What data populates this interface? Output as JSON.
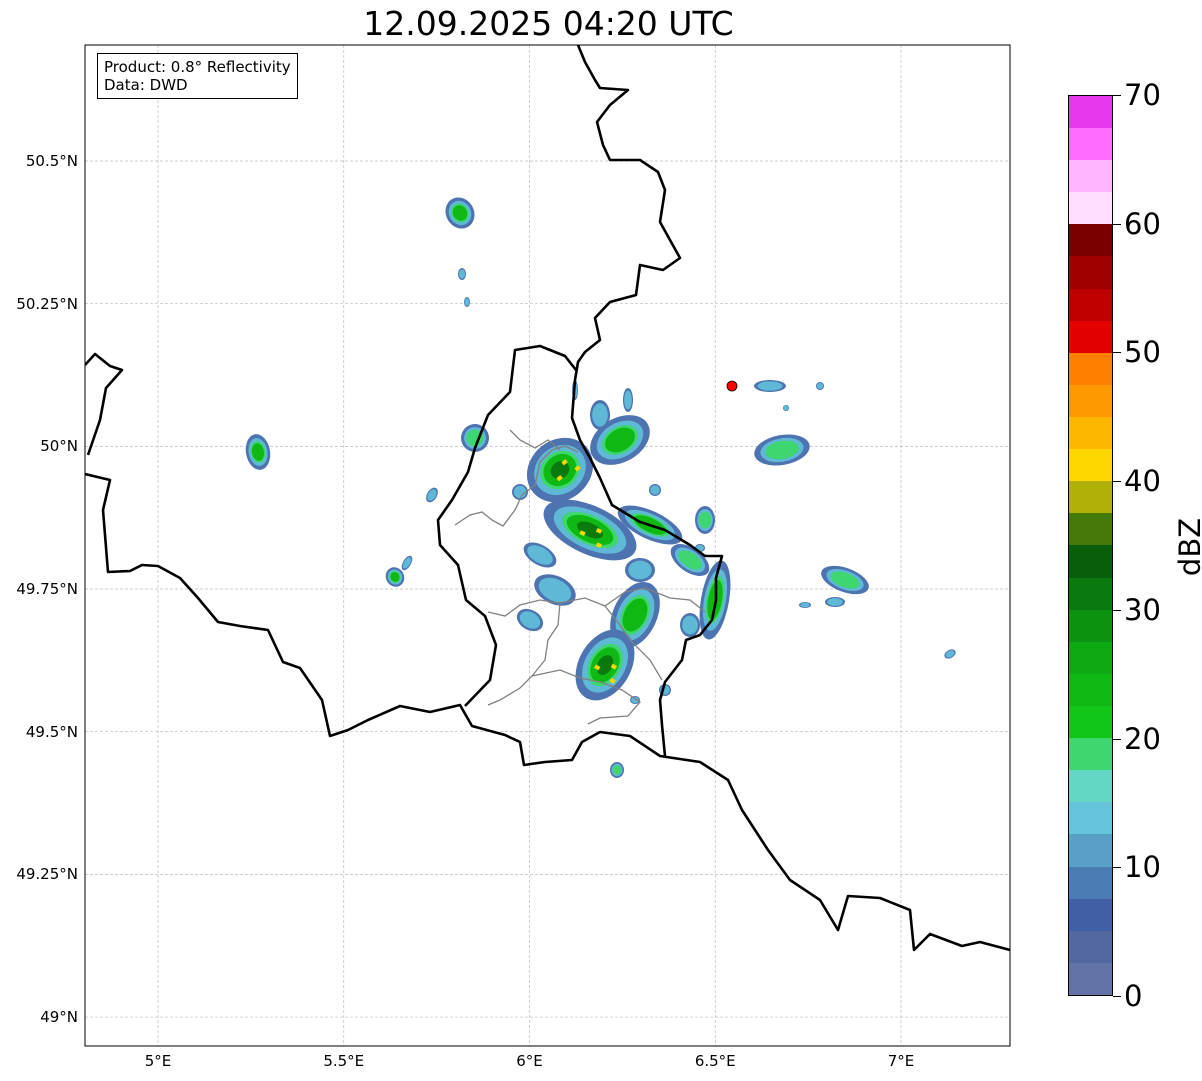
{
  "title": "12.09.2025 04:20 UTC",
  "legend": {
    "product": "Product: 0.8° Reflectivity",
    "data": "Data: DWD"
  },
  "y_ticks": [
    {
      "lat": 50.5,
      "label": "50.5°N"
    },
    {
      "lat": 50.25,
      "label": "50.25°N"
    },
    {
      "lat": 50.0,
      "label": "50°N"
    },
    {
      "lat": 49.75,
      "label": "49.75°N"
    },
    {
      "lat": 49.5,
      "label": "49.5°N"
    },
    {
      "lat": 49.25,
      "label": "49.25°N"
    },
    {
      "lat": 49.0,
      "label": "49°N"
    }
  ],
  "x_ticks": [
    {
      "lon": 5.0,
      "label": "5°E"
    },
    {
      "lon": 5.5,
      "label": "5.5°E"
    },
    {
      "lon": 6.0,
      "label": "6°E"
    },
    {
      "lon": 6.5,
      "label": "6.5°E"
    },
    {
      "lon": 7.0,
      "label": "7°E"
    }
  ],
  "colorbar": {
    "unit": "dBZ",
    "range": [
      0,
      70
    ],
    "step": 2.5,
    "tick_labels": [
      "0",
      "10",
      "20",
      "30",
      "40",
      "50",
      "60",
      "70"
    ],
    "colors": [
      "#6272a6",
      "#5468a0",
      "#415fa4",
      "#4a7bb2",
      "#5a9fc6",
      "#64c4dc",
      "#63d6c4",
      "#3ed66e",
      "#12c618",
      "#10b814",
      "#0ea812",
      "#0c9210",
      "#0b7a0e",
      "#095e0a",
      "#457a0a",
      "#b0b008",
      "#fed700",
      "#feb700",
      "#fe9a00",
      "#fe7e00",
      "#e20000",
      "#c00000",
      "#a00000",
      "#7a0000",
      "#ffdeff",
      "#ffb5ff",
      "#ff6cff",
      "#e838ee"
    ]
  },
  "radar_site": {
    "color": "#ff0000"
  }
}
